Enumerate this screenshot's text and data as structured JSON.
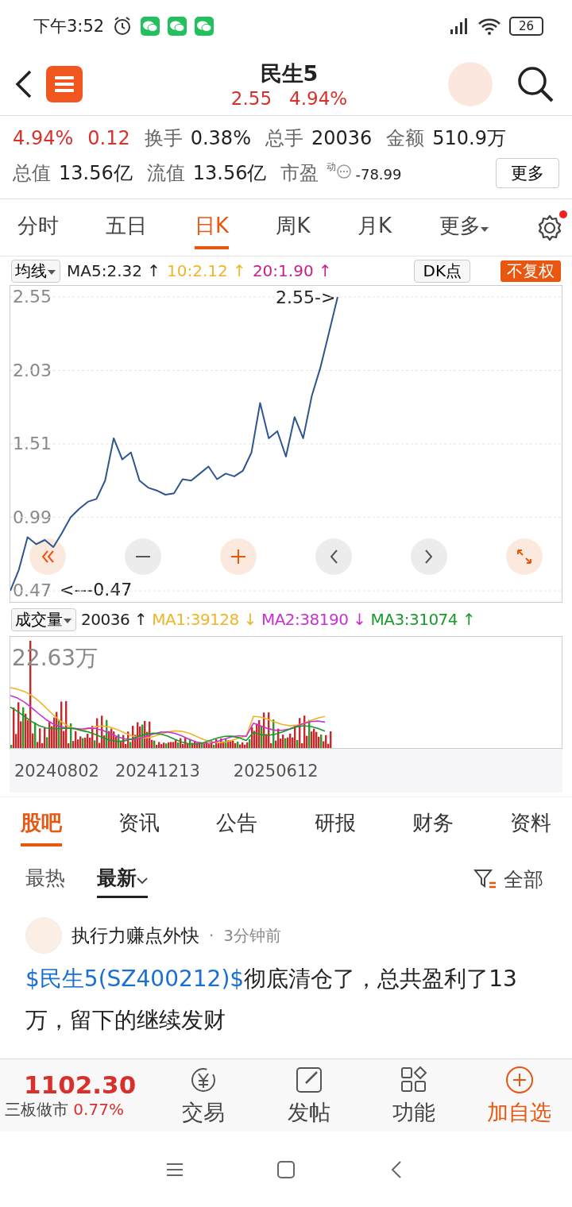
{
  "status_bar": {
    "time": "下午3:52",
    "battery": "26"
  },
  "header": {
    "title": "民生5",
    "price": "2.55",
    "change_pct": "4.94%"
  },
  "stats": {
    "row1": [
      {
        "kind": "value",
        "text": "4.94%"
      },
      {
        "kind": "value",
        "text": "0.12"
      },
      {
        "kind": "pair",
        "label": "换手",
        "value": "0.38%"
      },
      {
        "kind": "pair",
        "label": "总手",
        "value": "20036"
      },
      {
        "kind": "pair",
        "label": "金额",
        "value": "510.9万"
      }
    ],
    "row2": [
      {
        "kind": "pair",
        "label": "总值",
        "value": "13.56亿"
      },
      {
        "kind": "pair",
        "label": "流值",
        "value": "13.56亿"
      },
      {
        "kind": "pe",
        "label": "市盈",
        "sup": "动",
        "value": "-78.99"
      }
    ],
    "more_button": "更多"
  },
  "chart_tabs": [
    {
      "label": "分时",
      "selected": false
    },
    {
      "label": "五日",
      "selected": false
    },
    {
      "label": "日K",
      "selected": true
    },
    {
      "label": "周K",
      "selected": false
    },
    {
      "label": "月K",
      "selected": false
    },
    {
      "label": "更多",
      "selected": false,
      "kind": "dropdown"
    }
  ],
  "settings_badge": true,
  "ma_bar": {
    "selector": "均线",
    "items": [
      {
        "text": "MA5:2.32",
        "arrow": "↑",
        "color": "#222222"
      },
      {
        "text": "10:2.12",
        "arrow": "↑",
        "color": "#f0b429"
      },
      {
        "text": "20:1.90",
        "arrow": "↑",
        "color": "#c81e8c"
      }
    ],
    "dk": "DK点",
    "adjust": "不复权"
  },
  "price_chart": {
    "chart_data": {
      "type": "line",
      "grid": true,
      "ylim": [
        0.47,
        2.55
      ],
      "yticks": [
        2.55,
        2.03,
        1.51,
        0.99,
        0.47
      ],
      "series": [
        {
          "color": "#2f5590",
          "values": [
            0.47,
            0.62,
            0.85,
            0.8,
            0.83,
            0.78,
            0.88,
            0.99,
            1.05,
            1.1,
            1.12,
            1.25,
            1.55,
            1.4,
            1.45,
            1.25,
            1.2,
            1.18,
            1.15,
            1.16,
            1.26,
            1.25,
            1.3,
            1.35,
            1.26,
            1.3,
            1.28,
            1.32,
            1.45,
            1.8,
            1.55,
            1.6,
            1.42,
            1.7,
            1.55,
            1.85,
            2.05,
            2.3,
            2.55
          ]
        }
      ],
      "annotations": [
        "2.55->",
        "<---0.47"
      ]
    }
  },
  "volume_bar": {
    "selector": "成交量",
    "items": [
      {
        "text": "20036",
        "arrow": "↑",
        "color": "#222222"
      },
      {
        "text": "MA1:39128",
        "arrow": "↓",
        "color": "#f0b429"
      },
      {
        "text": "MA2:38190",
        "arrow": "↓",
        "color": "#c832d2"
      },
      {
        "text": "MA3:31074",
        "arrow": "↑",
        "color": "#1a9a2a"
      }
    ],
    "max_label": "22.63万",
    "dates": [
      "20240802",
      "20241213",
      "20250612"
    ]
  },
  "news_tabs": [
    {
      "label": "股吧",
      "selected": true
    },
    {
      "label": "资讯",
      "selected": false
    },
    {
      "label": "公告",
      "selected": false
    },
    {
      "label": "研报",
      "selected": false
    },
    {
      "label": "财务",
      "selected": false
    },
    {
      "label": "资料",
      "selected": false
    }
  ],
  "sort_tabs": [
    {
      "label": "最热",
      "selected": false
    },
    {
      "label": "最新",
      "selected": true
    }
  ],
  "filter": "全部",
  "post": {
    "author": "执行力赚点外快",
    "separator": "·",
    "time": "3分钟前",
    "stock_link": "$民生5(SZ400212)$",
    "text": "彻底清仓了，总共盈利了13万，留下的继续发财"
  },
  "bottom_bar": {
    "index_value": "1102.30",
    "index_name": "三板做市",
    "index_change": "0.77%",
    "actions": [
      {
        "kind": "trade",
        "label": "交易"
      },
      {
        "kind": "post",
        "label": "发帖"
      },
      {
        "kind": "tools",
        "label": "功能"
      },
      {
        "kind": "add",
        "label": "加自选"
      }
    ]
  }
}
